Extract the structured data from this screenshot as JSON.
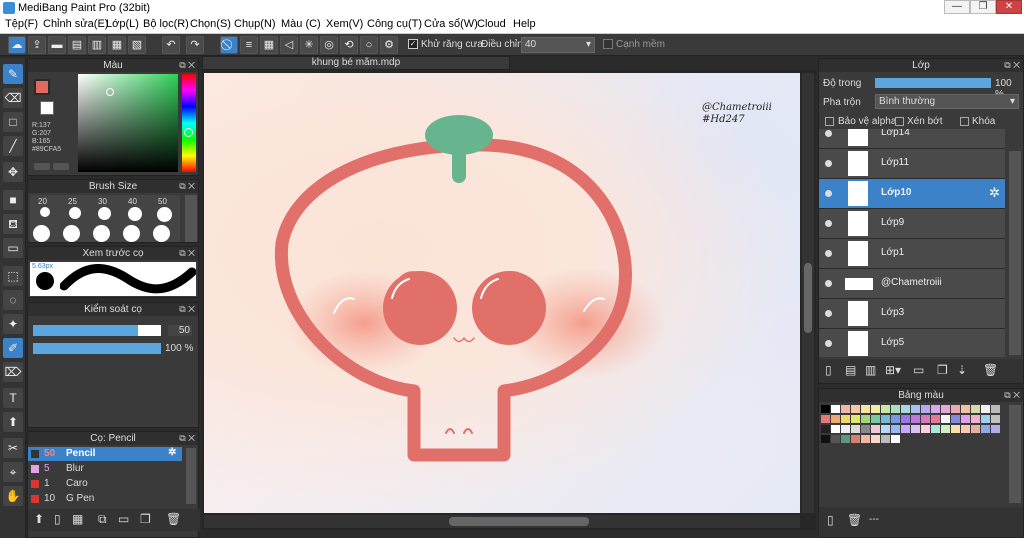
{
  "window": {
    "title": "MediBang Paint Pro (32bit)",
    "min": "—",
    "max": "❐",
    "close": "✕"
  },
  "menu": [
    "Tệp(F)",
    "Chỉnh sửa(E)",
    "Lớp(L)",
    "Bộ lọc(R)",
    "Chọn(S)",
    "Chụp(N)",
    "Màu (C)",
    "Xem(V)",
    "Công cụ(T)",
    "Cửa sổ(W)",
    "Cloud",
    "Help"
  ],
  "toolbar": {
    "antialias_label": "Khử răng cưa",
    "adjust_label": "Điều chỉnh",
    "adjust_value": "40",
    "edge_label": "Cạnh mềm"
  },
  "color_panel": {
    "title": "Màu",
    "r": "R:137",
    "g": "G:207",
    "b": "B:165",
    "hex": "#89CFA5",
    "fg": "#e06a5e",
    "bg": "#ffffff"
  },
  "brush_size": {
    "title": "Brush Size",
    "row1": [
      "20",
      "25",
      "30",
      "40",
      "50"
    ]
  },
  "preview": {
    "title": "Xem trước cọ",
    "size": "5.63px"
  },
  "brush_control": {
    "title": "Kiểm soát cọ",
    "size_val": "50",
    "opacity_val": "100 %",
    "size_frac": 0.82,
    "opacity_frac": 1.0
  },
  "brush_list": {
    "title": "Cọ: Pencil",
    "items": [
      {
        "size": "50",
        "name": "Pencil",
        "color": "#333333"
      },
      {
        "size": "5",
        "name": "Blur",
        "color": "#e4a1e4"
      },
      {
        "size": "1",
        "name": "Caro",
        "color": "#d33"
      },
      {
        "size": "10",
        "name": "G Pen",
        "color": "#d33"
      }
    ]
  },
  "canvas": {
    "tab": "khung bé mãm.mdp",
    "signature1": "@Chametroiii",
    "signature2": "#Hd247"
  },
  "layers": {
    "title": "Lớp",
    "opacity_label": "Độ trong",
    "opacity_val": "100 %",
    "opacity_frac": 1.0,
    "blend_label": "Pha trộn",
    "blend_val": "Bình thường",
    "protect_alpha": "Bảo vệ alpha",
    "clip": "Xén bớt",
    "lock": "Khóa",
    "items": [
      "Lớp14",
      "Lớp11",
      "Lớp10",
      "Lớp9",
      "Lớp1",
      "@Chametroiii",
      "Lớp3",
      "Lớp5"
    ]
  },
  "palette": {
    "title": "Bảng màu",
    "status": "---",
    "colors": [
      "#000000",
      "#ffffff",
      "#f4b6a8",
      "#f7c9a0",
      "#f6e4a0",
      "#f0eea0",
      "#c8e8a8",
      "#a8e0c0",
      "#a8d8e8",
      "#a8c0f0",
      "#b8a8f0",
      "#d8a8f0",
      "#e8a8d8",
      "#f0a8b8",
      "#f0c0a8",
      "#d8d8a8",
      "#f2f2f2",
      "#bbbbbb",
      "#e87878",
      "#f0a870",
      "#f0d870",
      "#e0e870",
      "#a0d880",
      "#78c8a0",
      "#78b8d8",
      "#7898e8",
      "#9878e8",
      "#c078e0",
      "#d878c0",
      "#e87898",
      "#f5f5f5",
      "#8888d8",
      "#e0a0f0",
      "#f0b0d0",
      "#a0d0f0",
      "#c0c0c0",
      "#222222",
      "#ffffff",
      "#eeeeee",
      "#dddddd",
      "#888888",
      "#f0c8d8",
      "#b8d8f8",
      "#98b8f0",
      "#c8a8f8",
      "#e0c0f0",
      "#f8d0e0",
      "#a8e8d8",
      "#d0f0c0",
      "#f8e0b0",
      "#f8c8b0",
      "#e8b0a0",
      "#90a8e8",
      "#b0b0e8",
      "#111111",
      "#555555",
      "#5a9a7a",
      "#d88070",
      "#f0b8a0",
      "#f8d8c8",
      "#bbbbbb",
      "#ffffff"
    ]
  }
}
